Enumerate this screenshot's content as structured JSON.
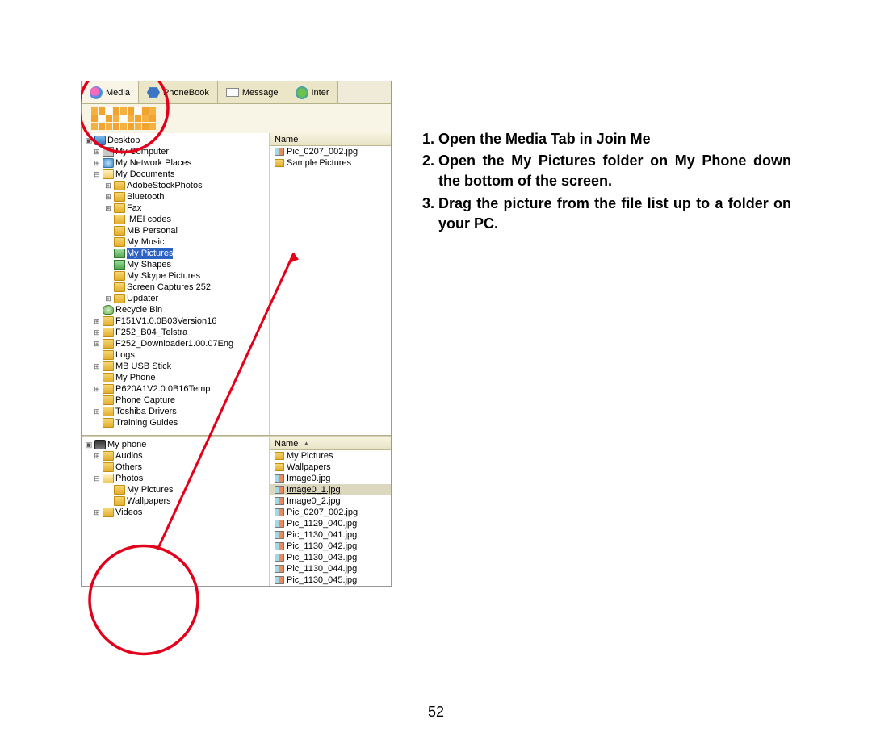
{
  "page_number": "52",
  "instructions": [
    "Open the Media Tab in Join Me",
    "Open the My Pictures folder on My Phone down the bottom of the screen.",
    "Drag the picture from the file list up to a folder on your PC."
  ],
  "tabs": [
    {
      "label": "Media",
      "icon": "media-icon",
      "active": true
    },
    {
      "label": "PhoneBook",
      "icon": "phonebook-icon",
      "active": false
    },
    {
      "label": "Message",
      "icon": "message-icon",
      "active": false
    },
    {
      "label": "Inter",
      "icon": "internet-icon",
      "active": false
    }
  ],
  "name_header": "Name",
  "pc_tree": {
    "root": "Desktop",
    "items": [
      {
        "depth": 0,
        "icon": "computer",
        "label": "My Computer",
        "exp": "+"
      },
      {
        "depth": 0,
        "icon": "network",
        "label": "My Network Places",
        "exp": "+"
      },
      {
        "depth": 0,
        "icon": "folderopen",
        "label": "My Documents",
        "exp": "-"
      },
      {
        "depth": 1,
        "icon": "folder",
        "label": "AdobeStockPhotos",
        "exp": "+"
      },
      {
        "depth": 1,
        "icon": "folder",
        "label": "Bluetooth",
        "exp": "+"
      },
      {
        "depth": 1,
        "icon": "folder",
        "label": "Fax",
        "exp": "+"
      },
      {
        "depth": 1,
        "icon": "folder",
        "label": "IMEI codes",
        "exp": ""
      },
      {
        "depth": 1,
        "icon": "folder",
        "label": "MB Personal",
        "exp": ""
      },
      {
        "depth": 1,
        "icon": "folder",
        "label": "My Music",
        "exp": ""
      },
      {
        "depth": 1,
        "icon": "picset",
        "label": "My Pictures",
        "exp": "",
        "selected": true
      },
      {
        "depth": 1,
        "icon": "picset",
        "label": "My Shapes",
        "exp": ""
      },
      {
        "depth": 1,
        "icon": "folder",
        "label": "My Skype Pictures",
        "exp": ""
      },
      {
        "depth": 1,
        "icon": "folder",
        "label": "Screen Captures 252",
        "exp": ""
      },
      {
        "depth": 1,
        "icon": "folder",
        "label": "Updater",
        "exp": "+"
      },
      {
        "depth": 0,
        "icon": "recycle",
        "label": "Recycle Bin",
        "exp": ""
      },
      {
        "depth": 0,
        "icon": "folder",
        "label": "F151V1.0.0B03Version16",
        "exp": "+"
      },
      {
        "depth": 0,
        "icon": "folder",
        "label": "F252_B04_Telstra",
        "exp": "+"
      },
      {
        "depth": 0,
        "icon": "folder",
        "label": "F252_Downloader1.00.07Eng",
        "exp": "+"
      },
      {
        "depth": 0,
        "icon": "folder",
        "label": "Logs",
        "exp": ""
      },
      {
        "depth": 0,
        "icon": "folder",
        "label": "MB USB Stick",
        "exp": "+"
      },
      {
        "depth": 0,
        "icon": "folder",
        "label": "My Phone",
        "exp": ""
      },
      {
        "depth": 0,
        "icon": "folder",
        "label": "P620A1V2.0.0B16Temp",
        "exp": "+"
      },
      {
        "depth": 0,
        "icon": "folder",
        "label": "Phone Capture",
        "exp": ""
      },
      {
        "depth": 0,
        "icon": "folder",
        "label": "Toshiba Drivers",
        "exp": "+"
      },
      {
        "depth": 0,
        "icon": "folder",
        "label": "Training Guides",
        "exp": ""
      }
    ]
  },
  "pc_files": [
    {
      "icon": "pic",
      "name": "Pic_0207_002.jpg"
    },
    {
      "icon": "fold",
      "name": "Sample Pictures"
    }
  ],
  "phone_tree": {
    "root": "My phone",
    "items": [
      {
        "depth": 0,
        "icon": "folder",
        "label": "Audios",
        "exp": "+"
      },
      {
        "depth": 0,
        "icon": "folder",
        "label": "Others",
        "exp": ""
      },
      {
        "depth": 0,
        "icon": "folderopen",
        "label": "Photos",
        "exp": "-"
      },
      {
        "depth": 1,
        "icon": "folder",
        "label": "My Pictures",
        "exp": ""
      },
      {
        "depth": 1,
        "icon": "folder",
        "label": "Wallpapers",
        "exp": ""
      },
      {
        "depth": 0,
        "icon": "folder",
        "label": "Videos",
        "exp": "+"
      }
    ]
  },
  "phone_files": [
    {
      "icon": "fold",
      "name": "My Pictures"
    },
    {
      "icon": "fold",
      "name": "Wallpapers"
    },
    {
      "icon": "pic",
      "name": "Image0.jpg"
    },
    {
      "icon": "pic",
      "name": "Image0_1.jpg",
      "selected": true
    },
    {
      "icon": "pic",
      "name": "Image0_2.jpg"
    },
    {
      "icon": "pic",
      "name": "Pic_0207_002.jpg"
    },
    {
      "icon": "pic",
      "name": "Pic_1129_040.jpg"
    },
    {
      "icon": "pic",
      "name": "Pic_1130_041.jpg"
    },
    {
      "icon": "pic",
      "name": "Pic_1130_042.jpg"
    },
    {
      "icon": "pic",
      "name": "Pic_1130_043.jpg"
    },
    {
      "icon": "pic",
      "name": "Pic_1130_044.jpg"
    },
    {
      "icon": "pic",
      "name": "Pic_1130_045.jpg"
    }
  ]
}
